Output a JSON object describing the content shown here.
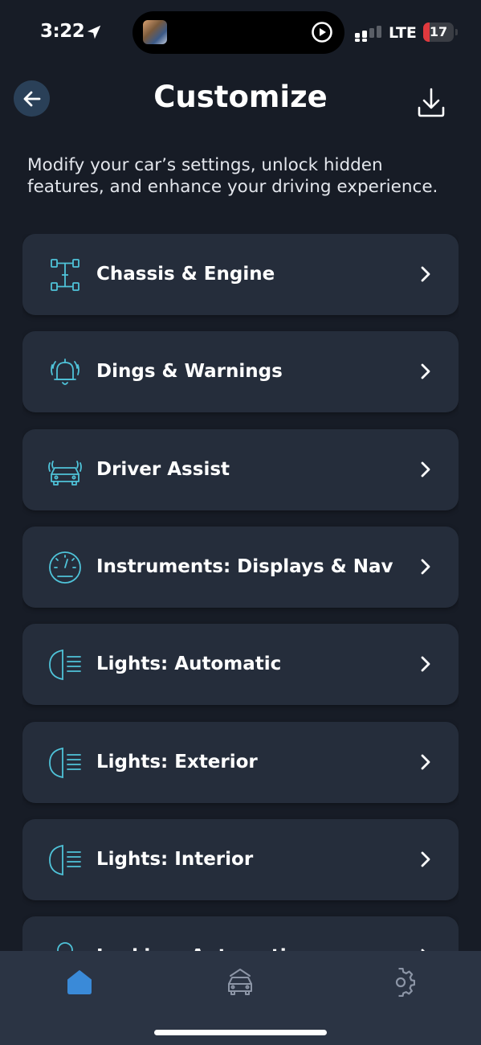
{
  "status_bar": {
    "time": "3:22",
    "network": "LTE",
    "battery_percent": "17",
    "battery_level": 0.17,
    "battery_color": "#e0393e"
  },
  "header": {
    "title": "Customize",
    "back_icon": "arrow-left-icon",
    "download_icon": "download-icon"
  },
  "subtitle": "Modify your car’s settings, unlock hidden features, and enhance your driving experience.",
  "accent_color": "#4fc3d9",
  "menu": {
    "items": [
      {
        "label": "Chassis & Engine",
        "icon": "chassis-icon"
      },
      {
        "label": "Dings & Warnings",
        "icon": "bell-icon"
      },
      {
        "label": "Driver Assist",
        "icon": "car-sensor-icon"
      },
      {
        "label": "Instruments: Displays & Nav",
        "icon": "gauge-icon"
      },
      {
        "label": "Lights: Automatic",
        "icon": "headlight-icon"
      },
      {
        "label": "Lights: Exterior",
        "icon": "headlight-icon"
      },
      {
        "label": "Lights: Interior",
        "icon": "headlight-icon"
      },
      {
        "label": "Locking: Automatic",
        "icon": "lock-icon"
      }
    ]
  },
  "tab_bar": {
    "tabs": [
      {
        "name": "home",
        "icon": "home-icon",
        "active": true
      },
      {
        "name": "vehicle",
        "icon": "car-icon",
        "active": false
      },
      {
        "name": "settings",
        "icon": "gear-icon",
        "active": false
      }
    ],
    "active_color": "#3a8ad8"
  }
}
